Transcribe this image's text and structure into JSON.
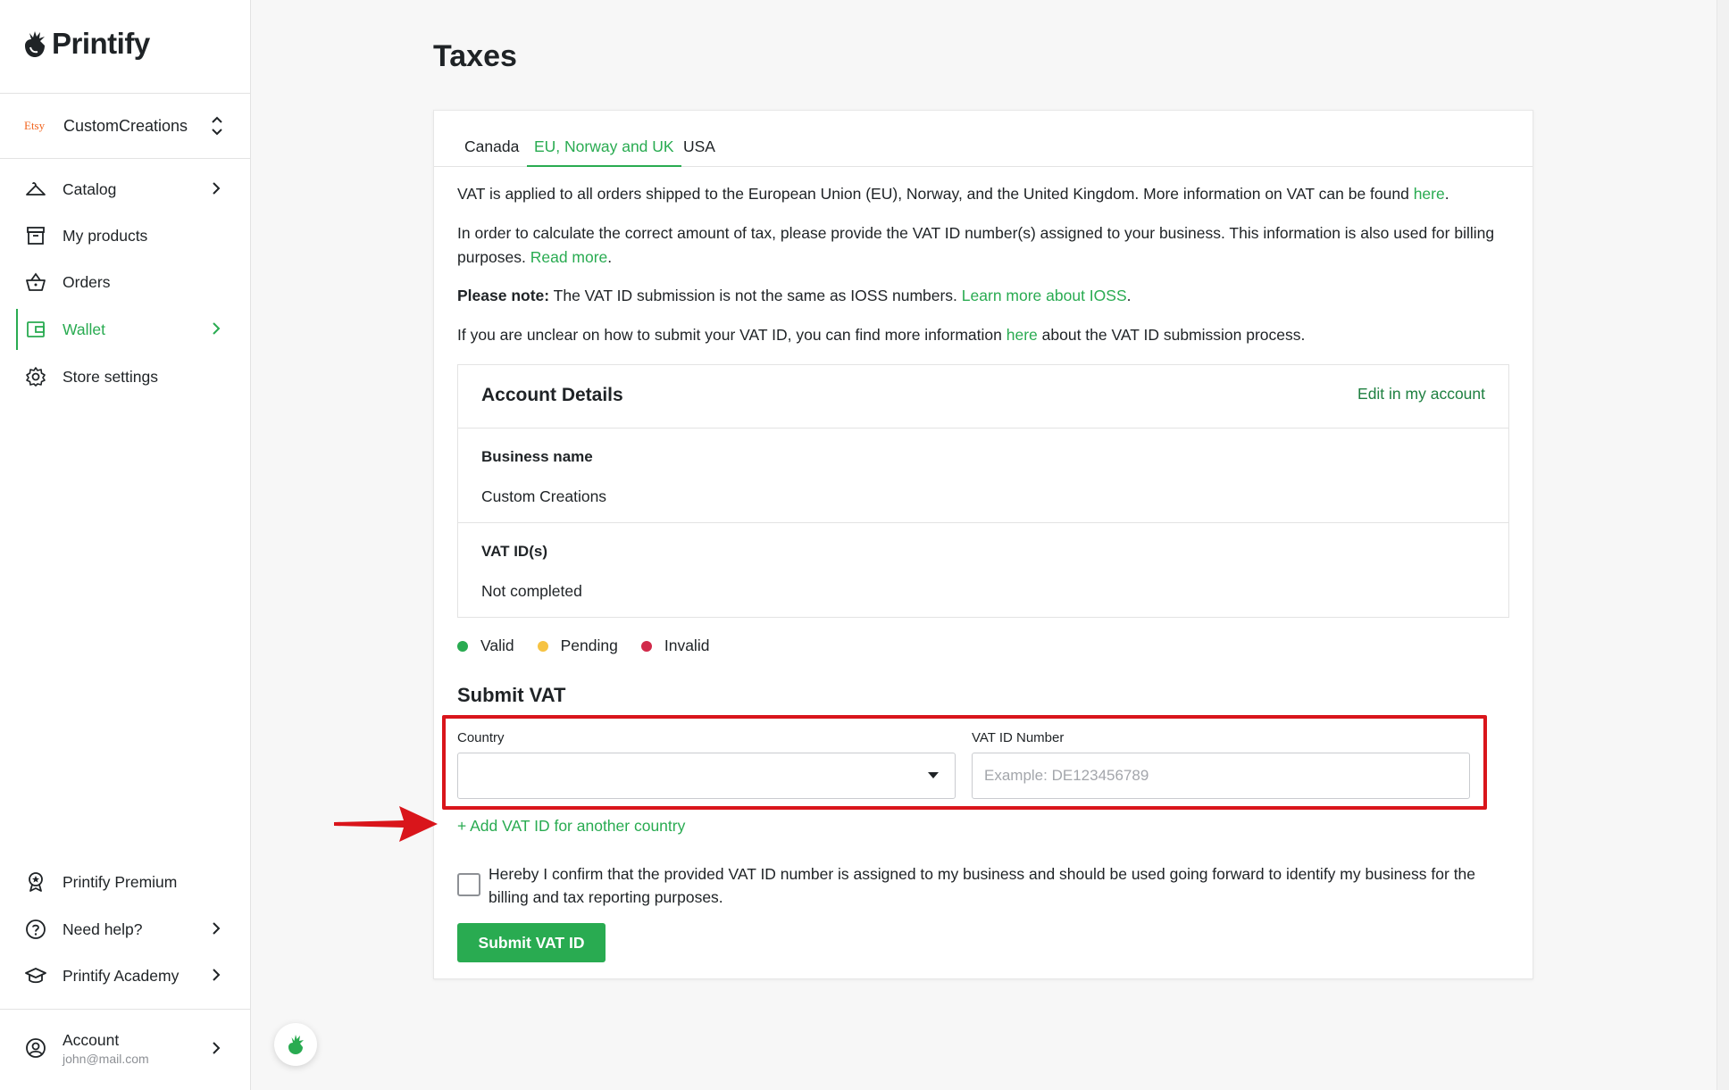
{
  "app": {
    "logo_text": "Printify"
  },
  "sidebar": {
    "store": {
      "platform_badge": "Etsy",
      "name": "CustomCreations"
    },
    "nav_items": [
      {
        "label": "Catalog",
        "icon": "hanger-icon"
      },
      {
        "label": "My products",
        "icon": "archive-box-icon"
      },
      {
        "label": "Orders",
        "icon": "basket-icon"
      },
      {
        "label": "Wallet",
        "icon": "wallet-icon",
        "active": true
      },
      {
        "label": "Store settings",
        "icon": "gear-icon"
      }
    ],
    "bottom_items": [
      {
        "label": "Printify Premium",
        "icon": "badge-icon"
      },
      {
        "label": "Need help?",
        "icon": "question-icon"
      },
      {
        "label": "Printify Academy",
        "icon": "graduation-cap-icon"
      }
    ],
    "account": {
      "label": "Account",
      "email": "john@mail.com"
    }
  },
  "main": {
    "title": "Taxes",
    "tabs": [
      {
        "label": "Canada"
      },
      {
        "label": "EU, Norway and UK",
        "active": true
      },
      {
        "label": "USA"
      }
    ],
    "paragraphs": {
      "p1_text": "VAT is applied to all orders shipped to the European Union (EU), Norway, and the United Kingdom. More information on VAT can be found ",
      "p1_link": "here",
      "p2_text": "In order to calculate the correct amount of tax, please provide the VAT ID number(s) assigned to your business. This information is also used for billing purposes. ",
      "p2_link": "Read more",
      "p3_bold": "Please note:",
      "p3_text": " The VAT ID submission is not the same as IOSS numbers. ",
      "p3_link": "Learn more about IOSS",
      "p4_text_a": "If you are unclear on how to submit your VAT ID, you can find more information ",
      "p4_link": "here",
      "p4_text_b": " about the VAT ID submission process.",
      "period": "."
    },
    "account_details": {
      "title": "Account Details",
      "edit_link": "Edit in my account",
      "business_name_label": "Business name",
      "business_name_value": "Custom Creations",
      "vat_ids_label": "VAT ID(s)",
      "vat_ids_value": "Not completed"
    },
    "legend": [
      {
        "label": "Valid",
        "color": "#29ab51"
      },
      {
        "label": "Pending",
        "color": "#f6c343"
      },
      {
        "label": "Invalid",
        "color": "#d12a4a"
      }
    ],
    "submit_vat": {
      "title": "Submit VAT",
      "country_label": "Country",
      "country_value": "",
      "vat_number_label": "VAT ID Number",
      "vat_number_placeholder": "Example: DE123456789",
      "add_link": "+ Add VAT ID for another country",
      "confirm_text": "Hereby I confirm that the provided VAT ID number is assigned to my business and should be used going forward to identify my business for the billing and tax reporting purposes.",
      "submit_label": "Submit VAT ID"
    }
  },
  "colors": {
    "brand_green": "#29ab51",
    "highlight_red": "#d9151b"
  }
}
